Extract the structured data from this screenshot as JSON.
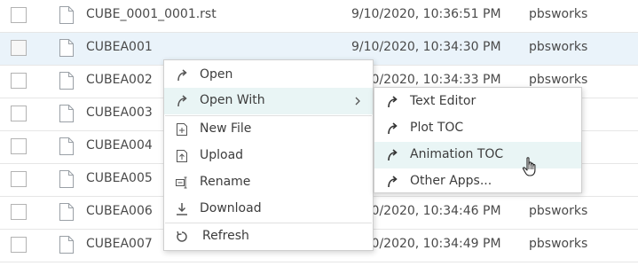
{
  "files": [
    {
      "name": "CUBE_0001_0001.rst",
      "date": "9/10/2020, 10:36:51 PM",
      "owner": "pbsworks",
      "selected": false
    },
    {
      "name": "CUBEA001",
      "date": "9/10/2020, 10:34:30 PM",
      "owner": "pbsworks",
      "selected": true
    },
    {
      "name": "CUBEA002",
      "date": "9/10/2020, 10:34:33 PM",
      "owner": "pbsworks",
      "selected": false
    },
    {
      "name": "CUBEA003",
      "date": "",
      "owner": "",
      "selected": false
    },
    {
      "name": "CUBEA004",
      "date": "",
      "owner": "",
      "selected": false
    },
    {
      "name": "CUBEA005",
      "date": "",
      "owner": "",
      "selected": false
    },
    {
      "name": "CUBEA006",
      "date": "9/10/2020, 10:34:46 PM",
      "owner": "pbsworks",
      "selected": false
    },
    {
      "name": "CUBEA007",
      "date": "9/10/2020, 10:34:49 PM",
      "owner": "pbsworks",
      "selected": false
    }
  ],
  "context_menu": {
    "open": "Open",
    "open_with": "Open With",
    "new_file": "New File",
    "upload": "Upload",
    "rename": "Rename",
    "download": "Download",
    "refresh": "Refresh"
  },
  "open_with_menu": {
    "text_editor": "Text Editor",
    "plot_toc": "Plot TOC",
    "animation_toc": "Animation TOC",
    "other_apps": "Other Apps..."
  },
  "colors": {
    "selected_row": "#eaf3fa",
    "menu_highlight": "#e9f5f5"
  }
}
